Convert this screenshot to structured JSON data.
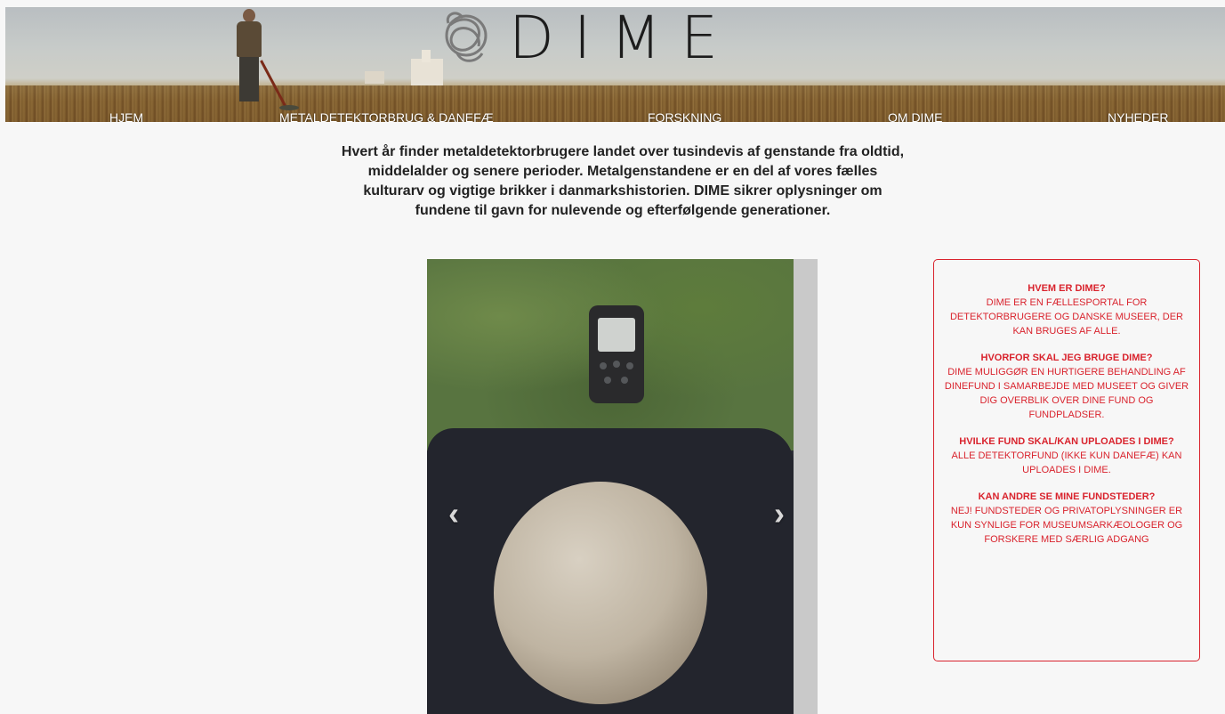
{
  "header": {
    "logo_text": "DIME",
    "nav": [
      {
        "label": "HJEM"
      },
      {
        "label": "METALDETEKTORBRUG & DANEFÆ"
      },
      {
        "label": "FORSKNING"
      },
      {
        "label": "OM DIME"
      },
      {
        "label": "NYHEDER"
      }
    ]
  },
  "intro": "Hvert år finder metaldetektorbrugere landet over tusindevis af genstande fra oldtid, middelalder og senere perioder. Metalgenstandene er en del af vores fælles kulturarv og vigtige brikker i danmarkshistorien. DIME sikrer oplysninger om fundene til gavn for nulevende og efterfølgende generationer.",
  "carousel": {
    "prev_icon": "chevron-left-icon",
    "next_icon": "chevron-right-icon",
    "prev_glyph": "‹",
    "next_glyph": "›"
  },
  "infobox": {
    "faq": [
      {
        "q": "HVEM ER DIME?",
        "a": "DIME ER EN FÆLLESPORTAL FOR DETEKTORBRUGERE OG DANSKE MUSEER, DER KAN BRUGES AF ALLE."
      },
      {
        "q": "HVORFOR SKAL JEG BRUGE DIME?",
        "a": "DIME MULIGGØR EN HURTIGERE BEHANDLING AF DINEFUND I SAMARBEJDE MED MUSEET OG GIVER DIG OVERBLIK OVER DINE FUND OG FUNDPLADSER."
      },
      {
        "q": "HVILKE FUND SKAL/KAN UPLOADES I DIME?",
        "a": "ALLE DETEKTORFUND (IKKE KUN DANEFÆ) KAN UPLOADES I DIME."
      },
      {
        "q": "KAN ANDRE SE MINE FUNDSTEDER?",
        "a": "NEJ! FUNDSTEDER OG PRIVATOPLYSNINGER ER KUN SYNLIGE FOR MUSEUMSARKÆOLOGER OG FORSKERE MED SÆRLIG ADGANG"
      }
    ]
  },
  "colors": {
    "accent_red": "#d9232d",
    "page_bg": "#f7f7f7"
  }
}
